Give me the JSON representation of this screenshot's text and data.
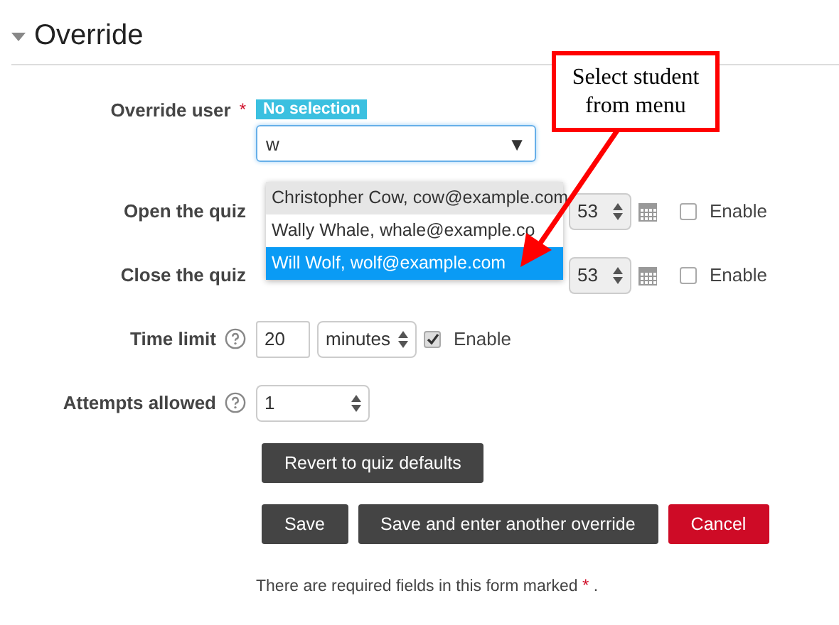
{
  "section": {
    "title": "Override",
    "expanded": true
  },
  "override_user": {
    "label": "Override user",
    "required_mark": "*",
    "badge": "No selection",
    "value": "w",
    "caret": "▼",
    "suggestions": [
      {
        "text": "Christopher Cow, cow@example.com",
        "selected": false,
        "hovered": true
      },
      {
        "text": "Wally Whale, whale@example.co",
        "selected": false,
        "hovered": false
      },
      {
        "text": "Will Wolf, wolf@example.com",
        "selected": true,
        "hovered": false
      }
    ]
  },
  "open_quiz": {
    "label": "Open the quiz",
    "minute": "53",
    "enable_label": "Enable",
    "enabled": false
  },
  "close_quiz": {
    "label": "Close the quiz",
    "minute": "53",
    "enable_label": "Enable",
    "enabled": false
  },
  "time_limit": {
    "label": "Time limit",
    "value": "20",
    "unit": "minutes",
    "enable_label": "Enable",
    "enabled": true
  },
  "attempts": {
    "label": "Attempts allowed",
    "value": "1"
  },
  "buttons": [
    {
      "label": "Revert to quiz defaults",
      "kind": "secondary"
    },
    {
      "label": "Save",
      "kind": "secondary"
    },
    {
      "label": "Save and enter another override",
      "kind": "secondary"
    },
    {
      "label": "Cancel",
      "kind": "danger"
    }
  ],
  "footer": {
    "text": "There are required fields in this form marked",
    "mark": "*",
    "end": "."
  },
  "callout": {
    "text": "Select student from menu"
  }
}
